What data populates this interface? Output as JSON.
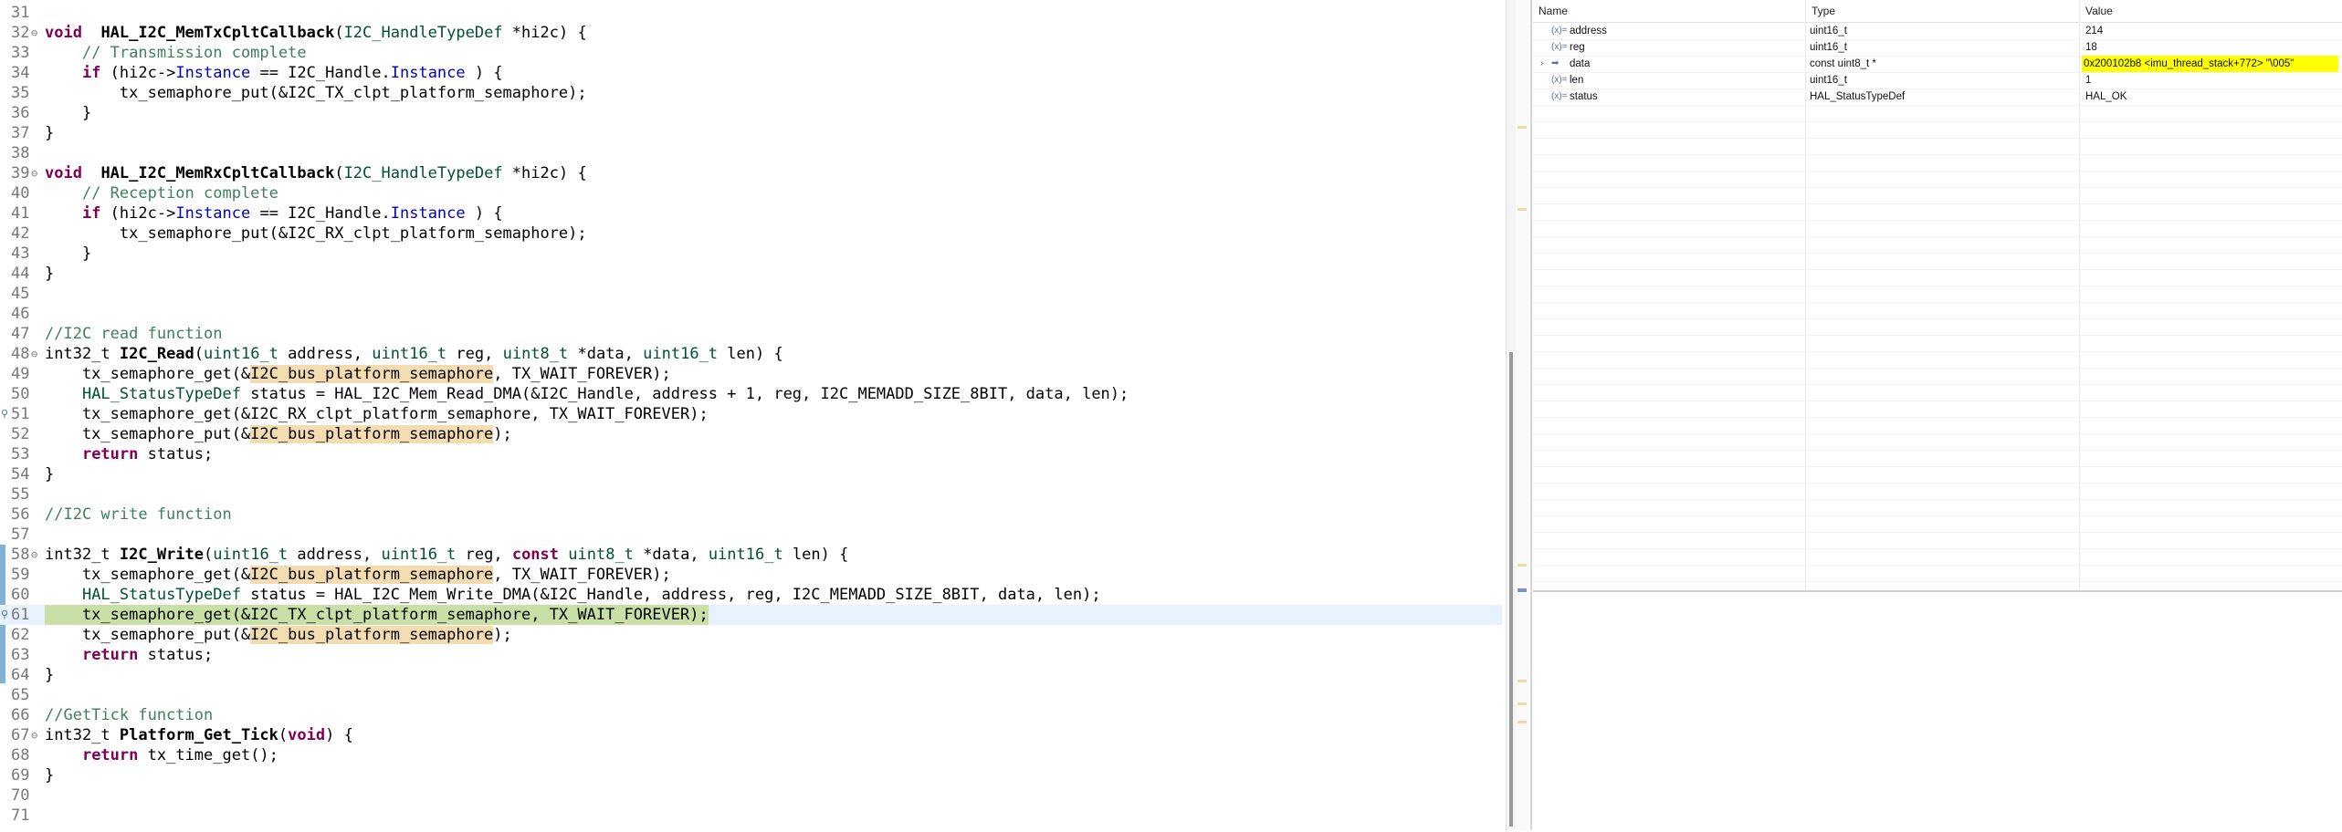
{
  "editor": {
    "lines": [
      {
        "n": "31",
        "fold": "",
        "tokens": []
      },
      {
        "n": "32",
        "fold": "⊖",
        "tokens": [
          [
            "kw",
            "void"
          ],
          [
            "",
            "  "
          ],
          [
            "fn",
            "HAL_I2C_MemTxCpltCallback"
          ],
          [
            "",
            "("
          ],
          [
            "ty",
            "I2C_HandleTypeDef"
          ],
          [
            "",
            " *hi2c) {"
          ]
        ]
      },
      {
        "n": "33",
        "fold": "",
        "tokens": [
          [
            "",
            "    "
          ],
          [
            "cm",
            "// Transmission complete"
          ]
        ]
      },
      {
        "n": "34",
        "fold": "",
        "tokens": [
          [
            "",
            "    "
          ],
          [
            "kw",
            "if"
          ],
          [
            "",
            " (hi2c->"
          ],
          [
            "fld",
            "Instance"
          ],
          [
            "",
            " == I2C_Handle."
          ],
          [
            "fld",
            "Instance"
          ],
          [
            "",
            " ) {"
          ]
        ]
      },
      {
        "n": "35",
        "fold": "",
        "tokens": [
          [
            "",
            "        tx_semaphore_put(&I2C_TX_clpt_platform_semaphore);"
          ]
        ]
      },
      {
        "n": "36",
        "fold": "",
        "tokens": [
          [
            "",
            "    }"
          ]
        ]
      },
      {
        "n": "37",
        "fold": "",
        "tokens": [
          [
            "",
            "}"
          ]
        ]
      },
      {
        "n": "38",
        "fold": "",
        "tokens": []
      },
      {
        "n": "39",
        "fold": "⊖",
        "tokens": [
          [
            "kw",
            "void"
          ],
          [
            "",
            "  "
          ],
          [
            "fn",
            "HAL_I2C_MemRxCpltCallback"
          ],
          [
            "",
            "("
          ],
          [
            "ty",
            "I2C_HandleTypeDef"
          ],
          [
            "",
            " *hi2c) {"
          ]
        ]
      },
      {
        "n": "40",
        "fold": "",
        "tokens": [
          [
            "",
            "    "
          ],
          [
            "cm",
            "// Reception complete"
          ]
        ]
      },
      {
        "n": "41",
        "fold": "",
        "tokens": [
          [
            "",
            "    "
          ],
          [
            "kw",
            "if"
          ],
          [
            "",
            " (hi2c->"
          ],
          [
            "fld",
            "Instance"
          ],
          [
            "",
            " == I2C_Handle."
          ],
          [
            "fld",
            "Instance"
          ],
          [
            "",
            " ) {"
          ]
        ]
      },
      {
        "n": "42",
        "fold": "",
        "tokens": [
          [
            "",
            "        tx_semaphore_put(&I2C_RX_clpt_platform_semaphore);"
          ]
        ]
      },
      {
        "n": "43",
        "fold": "",
        "tokens": [
          [
            "",
            "    }"
          ]
        ]
      },
      {
        "n": "44",
        "fold": "",
        "tokens": [
          [
            "",
            "}"
          ]
        ]
      },
      {
        "n": "45",
        "fold": "",
        "tokens": []
      },
      {
        "n": "46",
        "fold": "",
        "tokens": []
      },
      {
        "n": "47",
        "fold": "",
        "tokens": [
          [
            "cm",
            "//I2C read function"
          ]
        ]
      },
      {
        "n": "48",
        "fold": "⊖",
        "tokens": [
          [
            "",
            "int32_t "
          ],
          [
            "fn",
            "I2C_Read"
          ],
          [
            "",
            "("
          ],
          [
            "ty",
            "uint16_t"
          ],
          [
            "",
            " address, "
          ],
          [
            "ty",
            "uint16_t"
          ],
          [
            "",
            " reg, "
          ],
          [
            "ty",
            "uint8_t"
          ],
          [
            "",
            " *data, "
          ],
          [
            "ty",
            "uint16_t"
          ],
          [
            "",
            " len) {"
          ]
        ]
      },
      {
        "n": "49",
        "fold": "",
        "tokens": [
          [
            "",
            "    tx_semaphore_get(&"
          ],
          [
            "hl",
            "I2C_bus_platform_semaphore"
          ],
          [
            "",
            ", TX_WAIT_FOREVER);"
          ]
        ]
      },
      {
        "n": "50",
        "fold": "",
        "tokens": [
          [
            "",
            "    "
          ],
          [
            "ty",
            "HAL_StatusTypeDef"
          ],
          [
            "",
            " status = HAL_I2C_Mem_Read_DMA(&I2C_Handle, address + 1, reg, I2C_MEMADD_SIZE_8BIT, data, len);"
          ]
        ]
      },
      {
        "n": "51",
        "fold": "",
        "bp": true,
        "tokens": [
          [
            "",
            "    tx_semaphore_get(&I2C_RX_clpt_platform_semaphore, TX_WAIT_FOREVER);"
          ]
        ]
      },
      {
        "n": "52",
        "fold": "",
        "tokens": [
          [
            "",
            "    tx_semaphore_put(&"
          ],
          [
            "hl",
            "I2C_bus_platform_semaphore"
          ],
          [
            "",
            ");"
          ]
        ]
      },
      {
        "n": "53",
        "fold": "",
        "tokens": [
          [
            "",
            "    "
          ],
          [
            "kw",
            "return"
          ],
          [
            "",
            " status;"
          ]
        ]
      },
      {
        "n": "54",
        "fold": "",
        "tokens": [
          [
            "",
            "}"
          ]
        ]
      },
      {
        "n": "55",
        "fold": "",
        "tokens": []
      },
      {
        "n": "56",
        "fold": "",
        "tokens": [
          [
            "cm",
            "//I2C write function"
          ]
        ]
      },
      {
        "n": "57",
        "fold": "",
        "tokens": []
      },
      {
        "n": "58",
        "fold": "⊖",
        "tokens": [
          [
            "",
            "int32_t "
          ],
          [
            "fn",
            "I2C_Write"
          ],
          [
            "",
            "("
          ],
          [
            "ty",
            "uint16_t"
          ],
          [
            "",
            " address, "
          ],
          [
            "ty",
            "uint16_t"
          ],
          [
            "",
            " reg, "
          ],
          [
            "kw",
            "const"
          ],
          [
            "",
            " "
          ],
          [
            "ty",
            "uint8_t"
          ],
          [
            "",
            " *data, "
          ],
          [
            "ty",
            "uint16_t"
          ],
          [
            "",
            " len) {"
          ]
        ]
      },
      {
        "n": "59",
        "fold": "",
        "tokens": [
          [
            "",
            "    tx_semaphore_get(&"
          ],
          [
            "hl",
            "I2C_bus_platform_semaphore"
          ],
          [
            "",
            ", TX_WAIT_FOREVER);"
          ]
        ]
      },
      {
        "n": "60",
        "fold": "",
        "tokens": [
          [
            "",
            "    "
          ],
          [
            "ty",
            "HAL_StatusTypeDef"
          ],
          [
            "",
            " status = HAL_I2C_Mem_Write_DMA(&I2C_Handle, address, reg, I2C_MEMADD_SIZE_8BIT, data, len);"
          ]
        ]
      },
      {
        "n": "61",
        "fold": "",
        "bp": true,
        "exec": true,
        "tokens": [
          [
            "",
            "    tx_semaphore_get(&I2C_TX_clpt_platform_semaphore, TX_WAIT_FOREVER);"
          ]
        ]
      },
      {
        "n": "62",
        "fold": "",
        "tokens": [
          [
            "",
            "    tx_semaphore_put(&"
          ],
          [
            "hl",
            "I2C_bus_platform_semaphore"
          ],
          [
            "",
            ");"
          ]
        ]
      },
      {
        "n": "63",
        "fold": "",
        "tokens": [
          [
            "",
            "    "
          ],
          [
            "kw",
            "return"
          ],
          [
            "",
            " status;"
          ]
        ]
      },
      {
        "n": "64",
        "fold": "",
        "tokens": [
          [
            "",
            "}"
          ]
        ]
      },
      {
        "n": "65",
        "fold": "",
        "tokens": []
      },
      {
        "n": "66",
        "fold": "",
        "tokens": [
          [
            "cm",
            "//GetTick function"
          ]
        ]
      },
      {
        "n": "67",
        "fold": "⊖",
        "tokens": [
          [
            "",
            "int32_t "
          ],
          [
            "fn",
            "Platform_Get_Tick"
          ],
          [
            "",
            "("
          ],
          [
            "kw",
            "void"
          ],
          [
            "",
            ") {"
          ]
        ]
      },
      {
        "n": "68",
        "fold": "",
        "tokens": [
          [
            "",
            "    "
          ],
          [
            "kw",
            "return"
          ],
          [
            "",
            " tx_time_get();"
          ]
        ]
      },
      {
        "n": "69",
        "fold": "",
        "tokens": [
          [
            "",
            "}"
          ]
        ]
      },
      {
        "n": "70",
        "fold": "",
        "tokens": []
      },
      {
        "n": "71",
        "fold": "",
        "tokens": []
      }
    ]
  },
  "variables": {
    "headers": {
      "name": "Name",
      "type": "Type",
      "value": "Value"
    },
    "rows": [
      {
        "name": "address",
        "type": "uint16_t",
        "value": "214",
        "icon": "(x)=",
        "expand": "",
        "changed": false
      },
      {
        "name": "reg",
        "type": "uint16_t",
        "value": "18",
        "icon": "(x)=",
        "expand": "",
        "changed": false
      },
      {
        "name": "data",
        "type": "const uint8_t *",
        "value": "0x200102b8 <imu_thread_stack+772> \"\\005\"",
        "icon": "➡",
        "expand": "›",
        "changed": true
      },
      {
        "name": "len",
        "type": "uint16_t",
        "value": "1",
        "icon": "(x)=",
        "expand": "",
        "changed": false
      },
      {
        "name": "status",
        "type": "HAL_StatusTypeDef",
        "value": "HAL_OK",
        "icon": "(x)=",
        "expand": "",
        "changed": false
      }
    ]
  }
}
